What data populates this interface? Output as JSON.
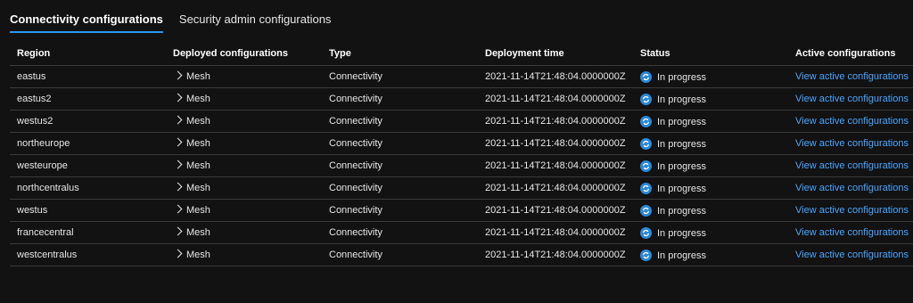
{
  "tabs": [
    {
      "label": "Connectivity configurations",
      "active": true
    },
    {
      "label": "Security admin configurations",
      "active": false
    }
  ],
  "table": {
    "headers": {
      "region": "Region",
      "deployed": "Deployed configurations",
      "type": "Type",
      "time": "Deployment time",
      "status": "Status",
      "active": "Active configurations"
    },
    "rows": [
      {
        "region": "eastus",
        "deployed": "Mesh",
        "type": "Connectivity",
        "time": "2021-11-14T21:48:04.0000000Z",
        "status": "In progress",
        "link": "View active configurations"
      },
      {
        "region": "eastus2",
        "deployed": "Mesh",
        "type": "Connectivity",
        "time": "2021-11-14T21:48:04.0000000Z",
        "status": "In progress",
        "link": "View active configurations"
      },
      {
        "region": "westus2",
        "deployed": "Mesh",
        "type": "Connectivity",
        "time": "2021-11-14T21:48:04.0000000Z",
        "status": "In progress",
        "link": "View active configurations"
      },
      {
        "region": "northeurope",
        "deployed": "Mesh",
        "type": "Connectivity",
        "time": "2021-11-14T21:48:04.0000000Z",
        "status": "In progress",
        "link": "View active configurations"
      },
      {
        "region": "westeurope",
        "deployed": "Mesh",
        "type": "Connectivity",
        "time": "2021-11-14T21:48:04.0000000Z",
        "status": "In progress",
        "link": "View active configurations"
      },
      {
        "region": "northcentralus",
        "deployed": "Mesh",
        "type": "Connectivity",
        "time": "2021-11-14T21:48:04.0000000Z",
        "status": "In progress",
        "link": "View active configurations"
      },
      {
        "region": "westus",
        "deployed": "Mesh",
        "type": "Connectivity",
        "time": "2021-11-14T21:48:04.0000000Z",
        "status": "In progress",
        "link": "View active configurations"
      },
      {
        "region": "francecentral",
        "deployed": "Mesh",
        "type": "Connectivity",
        "time": "2021-11-14T21:48:04.0000000Z",
        "status": "In progress",
        "link": "View active configurations"
      },
      {
        "region": "westcentralus",
        "deployed": "Mesh",
        "type": "Connectivity",
        "time": "2021-11-14T21:48:04.0000000Z",
        "status": "In progress",
        "link": "View active configurations"
      }
    ]
  },
  "icons": {
    "status": "sync-in-progress-icon",
    "expand": "chevron-right-icon"
  },
  "colors": {
    "background": "#121212",
    "accent": "#2899f5",
    "link": "#4aa6ff",
    "status_icon": "#2b88d8"
  }
}
